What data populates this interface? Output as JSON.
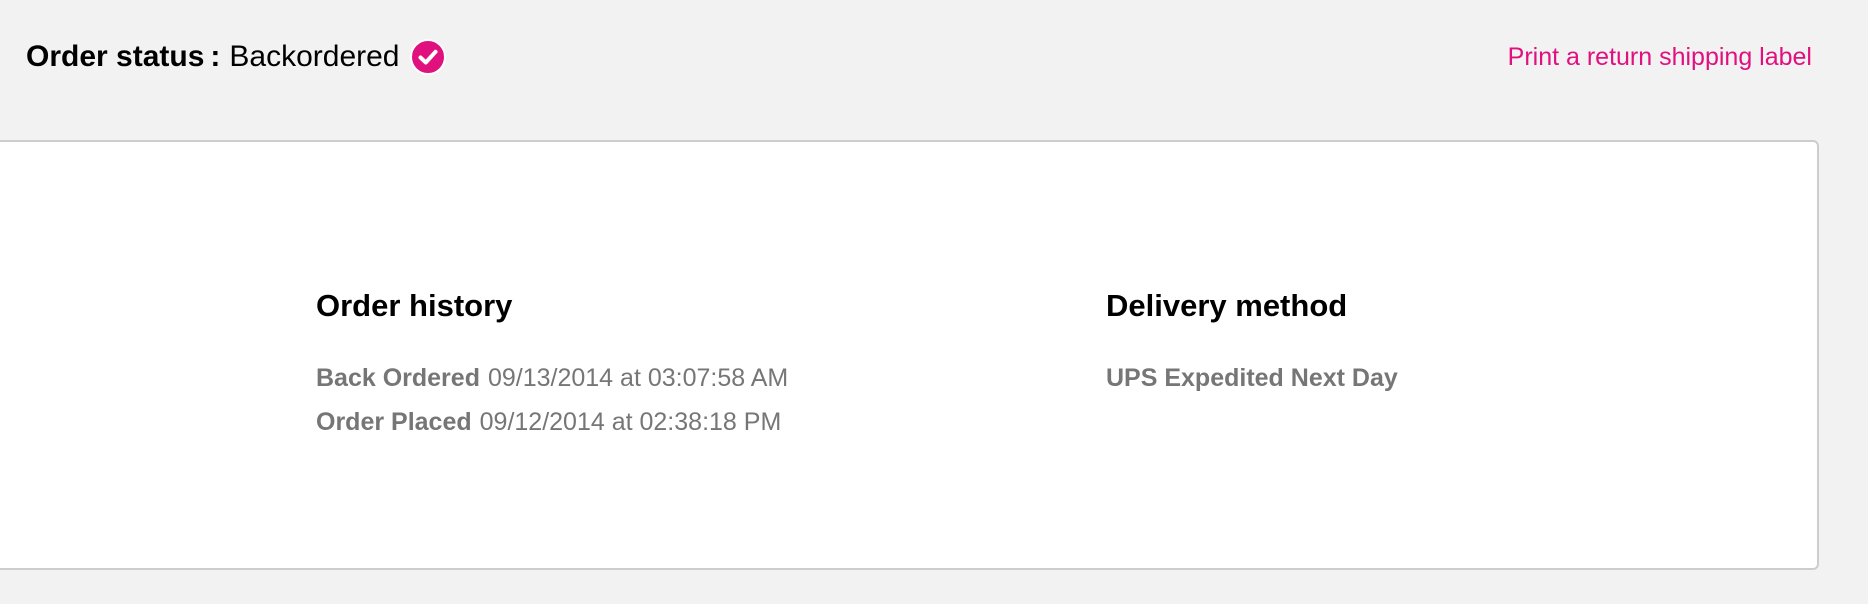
{
  "header": {
    "status_label": "Order status",
    "status_separator": ":",
    "status_value": "Backordered",
    "status_icon": "check-circle-icon",
    "return_link": "Print a return shipping label"
  },
  "order_history": {
    "title": "Order history",
    "events": [
      {
        "event": "Back Ordered",
        "datetime": "09/13/2014 at 03:07:58 AM"
      },
      {
        "event": "Order Placed",
        "datetime": "09/12/2014 at 02:38:18 PM"
      }
    ]
  },
  "delivery": {
    "title": "Delivery method",
    "method": "UPS Expedited Next Day"
  },
  "colors": {
    "accent": "#e0107f",
    "background": "#f2f2f2",
    "panel": "#ffffff",
    "muted_text": "#767676",
    "panel_border": "#cdcdcd"
  }
}
